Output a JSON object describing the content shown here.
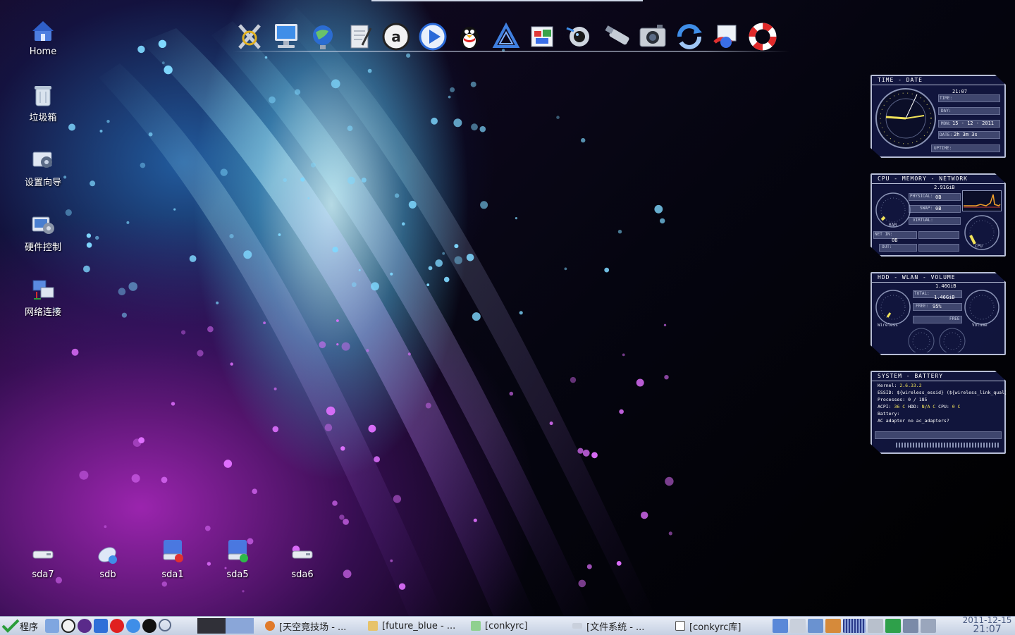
{
  "desktop": {
    "icons_left": [
      {
        "label": "Home",
        "icon": "home-folder-icon"
      },
      {
        "label": "垃圾箱",
        "icon": "trash-icon"
      },
      {
        "label": "设置向导",
        "icon": "setup-wizard-icon"
      },
      {
        "label": "硬件控制",
        "icon": "hardware-control-icon"
      },
      {
        "label": "网络连接",
        "icon": "network-connection-icon"
      }
    ],
    "drives": [
      {
        "label": "sda7",
        "icon": "hard-drive-icon"
      },
      {
        "label": "sdb",
        "icon": "removable-disk-icon"
      },
      {
        "label": "sda1",
        "icon": "mounted-drive-icon"
      },
      {
        "label": "sda5",
        "icon": "mounted-drive-icon"
      },
      {
        "label": "sda6",
        "icon": "hard-drive-icon"
      }
    ]
  },
  "dock": {
    "items": [
      "crossed-tools-icon",
      "monitor-icon",
      "globe-icon",
      "text-editor-icon",
      "amarok-icon",
      "media-player-icon",
      "qq-penguin-icon",
      "triangle-app-icon",
      "office-icon",
      "webcam-icon",
      "usb-stick-icon",
      "camera-icon",
      "refresh-icon",
      "browser-icon",
      "lifebuoy-icon"
    ]
  },
  "conky": {
    "time_date": {
      "title": "TIME - DATE",
      "time_label": "TIME:",
      "time_value": "21:07",
      "day_label": "DAY:",
      "mon_label": "MON:",
      "mon_value": "15 - 12 - 2011",
      "date_label": "DATE:",
      "date_value": "2h 3m 3s",
      "uptime_label": "UPTIME:"
    },
    "cpu_mem": {
      "title": "CPU - MEMORY - NETWORK",
      "mem_value": "2.91GiB",
      "physical_label": "PHYSICAL:",
      "physical_value": "0B",
      "swap_label": "SWAP:",
      "swap_value": "0B",
      "virtual_label": "VIRTUAL:",
      "ram_label": "RAM",
      "netin_label": "NET IN:",
      "netin_value": "0B",
      "out_label": "OUT:",
      "cpu_label": "CPU"
    },
    "hdd": {
      "title": "HDD - WLAN - VOLUME",
      "size_value": "1.46GiB",
      "total_label": "TOTAL:",
      "total_value": "1.46GiB",
      "free_label": "FREE:",
      "free_value": "95%",
      "free2_label": "FREE",
      "wireless_label": "Wireless",
      "volume_label": "Volume"
    },
    "system": {
      "title": "SYSTEM - BATTERY",
      "kernel_label": "Kernel:",
      "kernel_value": "2.6.33.2",
      "essid_line": "ESSID: ${wireless_essid} (${wireless_link_qual}%)",
      "processes_label": "Processes:",
      "processes_value": "0  / 185",
      "acpi_label": "ACPI:",
      "acpi_value": "36 C",
      "hdd_label": "HDD:",
      "hdd_value": "N/A C",
      "cpu_label": "CPU:",
      "cpu_value": "0 C",
      "battery_label": "Battery:",
      "battery_value": "AC adaptor no ac_adapters?"
    }
  },
  "taskbar": {
    "start_label": "程序",
    "quick_launch": [
      "file-manager-icon",
      "amarok-icon",
      "media-icon",
      "desktop-icon",
      "opera-icon",
      "network-icon",
      "qq-icon",
      "search-icon"
    ],
    "tasks": [
      {
        "label": "[天空竞技场 - ...",
        "icon": "firefox-icon"
      },
      {
        "label": "[future_blue - ...",
        "icon": "folder-icon"
      },
      {
        "label": "[conkyrc]",
        "icon": "text-editor-icon"
      },
      {
        "label": "[文件系统 - ...",
        "icon": "drive-icon"
      },
      {
        "label": "[conkyrc库]",
        "icon": "window-icon"
      }
    ],
    "tray": [
      "screen-icon",
      "audio-device-icon",
      "display-icon",
      "file-manager-icon",
      "network-status-icon",
      "keyboard-icon",
      "battery-icon",
      "network-icon",
      "volume-icon"
    ],
    "clock_date": "2011-12-15",
    "clock_time": "21:07"
  },
  "colors": {
    "accent": "#3a6ee8",
    "conky_bg": "#141846",
    "conky_border": "#b7bed6",
    "conky_highlight": "#f2e35a"
  }
}
